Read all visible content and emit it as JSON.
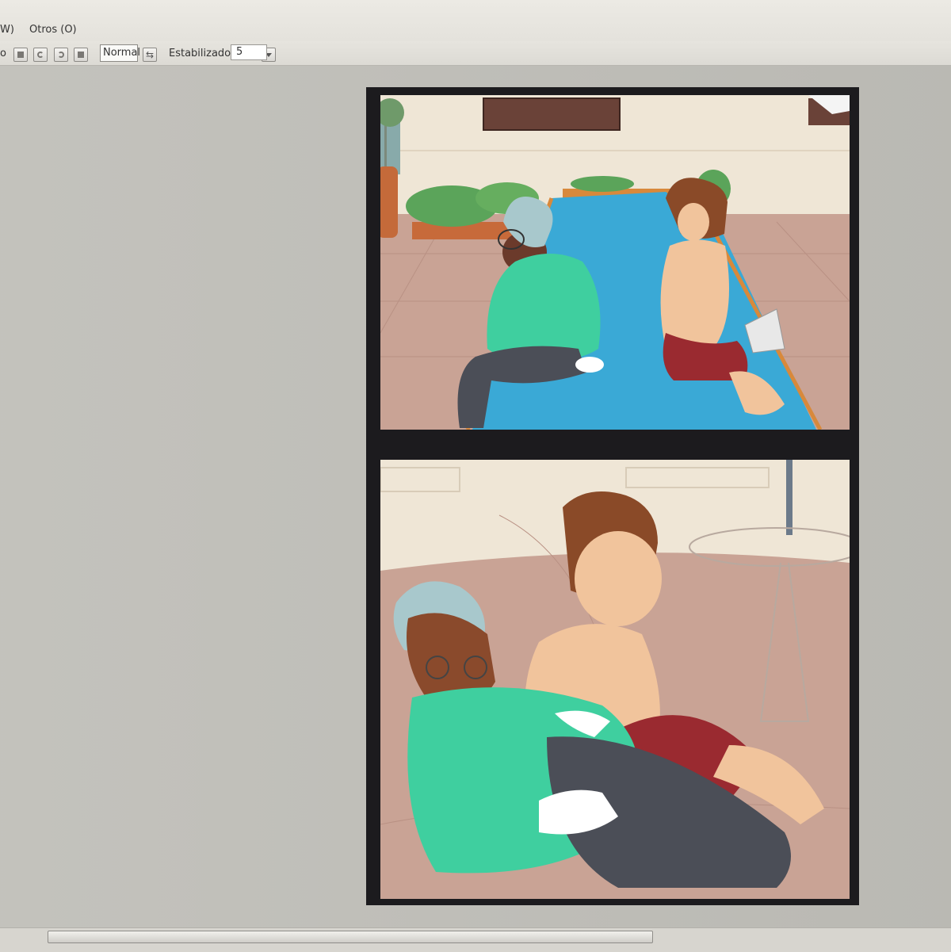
{
  "menubar": {
    "items": [
      {
        "label": "W)"
      },
      {
        "label": "Otros (O)"
      }
    ]
  },
  "toolbar": {
    "left_label": "o",
    "blend_mode": "Normal",
    "stabilizer_label": "Estabilizador",
    "stabilizer_value": "5"
  },
  "icons": [
    "square-icon",
    "rotate-left-icon",
    "rotate-right-icon",
    "stop-icon",
    "swap-icon",
    "dropdown-arrow-icon"
  ],
  "colors": {
    "page_border": "#1c1b1e",
    "workspace": "#c0bfb9",
    "pool_blue": "#3aa9d6",
    "sweater_green": "#3fcf9f",
    "shorts_red": "#9a2a30"
  }
}
